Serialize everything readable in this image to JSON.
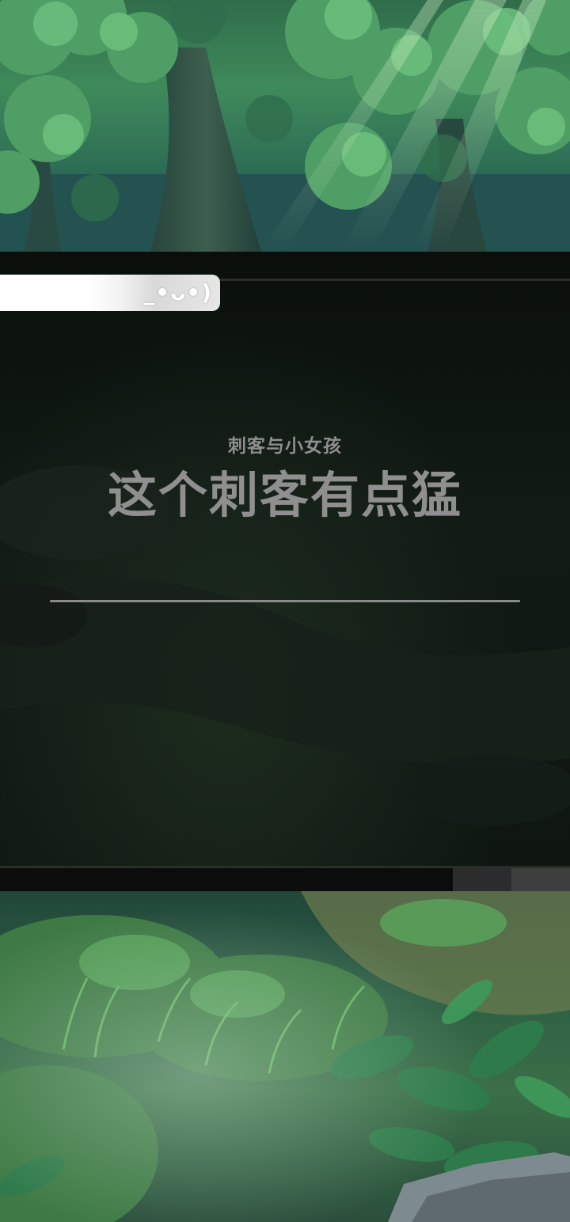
{
  "story": {
    "series_title": "刺客与小女孩",
    "chapter_title": "这个刺客有点猛"
  },
  "loading": {
    "kaomoji": "_•ᴗ•)",
    "progress_percent": 38
  },
  "colors": {
    "band": "#0f1611",
    "title_text": "#8f8f8f",
    "divider": "#8a8a8a",
    "progress_bar": "#ffffff",
    "forest_green": "#3f8a5b"
  },
  "icons": {
    "kaomoji_face": "kaomoji-face-icon"
  }
}
